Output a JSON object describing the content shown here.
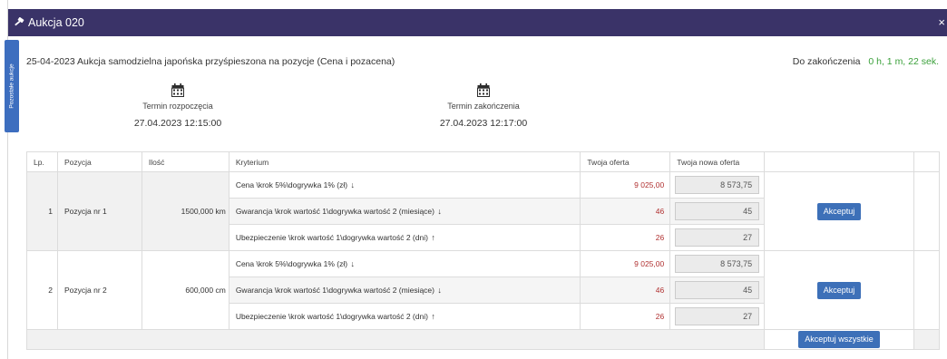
{
  "window": {
    "title": "Aukcja 020",
    "close": "×"
  },
  "side_tab": {
    "label": "Pozostałe aukcje"
  },
  "subtitle": "25-04-2023 Aukcja samodzielna japońska przyśpieszona na pozycje (Cena i pozacena)",
  "countdown": {
    "label": "Do zakończenia",
    "value": "0 h, 1 m, 22 sek."
  },
  "start": {
    "label": "Termin rozpoczęcia",
    "date": "27.04.2023 12:15:00"
  },
  "end": {
    "label": "Termin zakończenia",
    "date": "27.04.2023 12:17:00"
  },
  "table": {
    "headers": {
      "lp": "Lp.",
      "pozycja": "Pozycja",
      "ilosc": "Ilość",
      "kryterium": "Kryterium",
      "oferta": "Twoja oferta",
      "nowa": "Twoja nowa oferta"
    },
    "rows": [
      {
        "lp": "1",
        "pozycja": "Pozycja nr 1",
        "ilosc": "1500,000 km",
        "criteria": [
          {
            "name": "Cena \\krok 5%\\dogrywka 1% (zł)",
            "arrow": "↓",
            "offer": "9 025,00",
            "new": "8 573,75"
          },
          {
            "name": "Gwarancja \\krok wartość 1\\dogrywka wartość 2 (miesiące)",
            "arrow": "↓",
            "offer": "46",
            "new": "45"
          },
          {
            "name": "Ubezpieczenie \\krok wartość 1\\dogrywka wartość 2 (dni)",
            "arrow": "↑",
            "offer": "26",
            "new": "27"
          }
        ],
        "button": "Akceptuj"
      },
      {
        "lp": "2",
        "pozycja": "Pozycja nr 2",
        "ilosc": "600,000 cm",
        "criteria": [
          {
            "name": "Cena \\krok 5%\\dogrywka 1% (zł)",
            "arrow": "↓",
            "offer": "9 025,00",
            "new": "8 573,75"
          },
          {
            "name": "Gwarancja \\krok wartość 1\\dogrywka wartość 2 (miesiące)",
            "arrow": "↓",
            "offer": "46",
            "new": "45"
          },
          {
            "name": "Ubezpieczenie \\krok wartość 1\\dogrywka wartość 2 (dni)",
            "arrow": "↑",
            "offer": "26",
            "new": "27"
          }
        ],
        "button": "Akceptuj"
      }
    ],
    "accept_all": "Akceptuj wszystkie"
  },
  "colors": {
    "header": "#3a3368",
    "button": "#3d70b8",
    "offer": "#b03030",
    "countdown": "#3aa03a"
  },
  "icons": {
    "window": "gavel-icon",
    "calendar": "calendar-icon"
  }
}
